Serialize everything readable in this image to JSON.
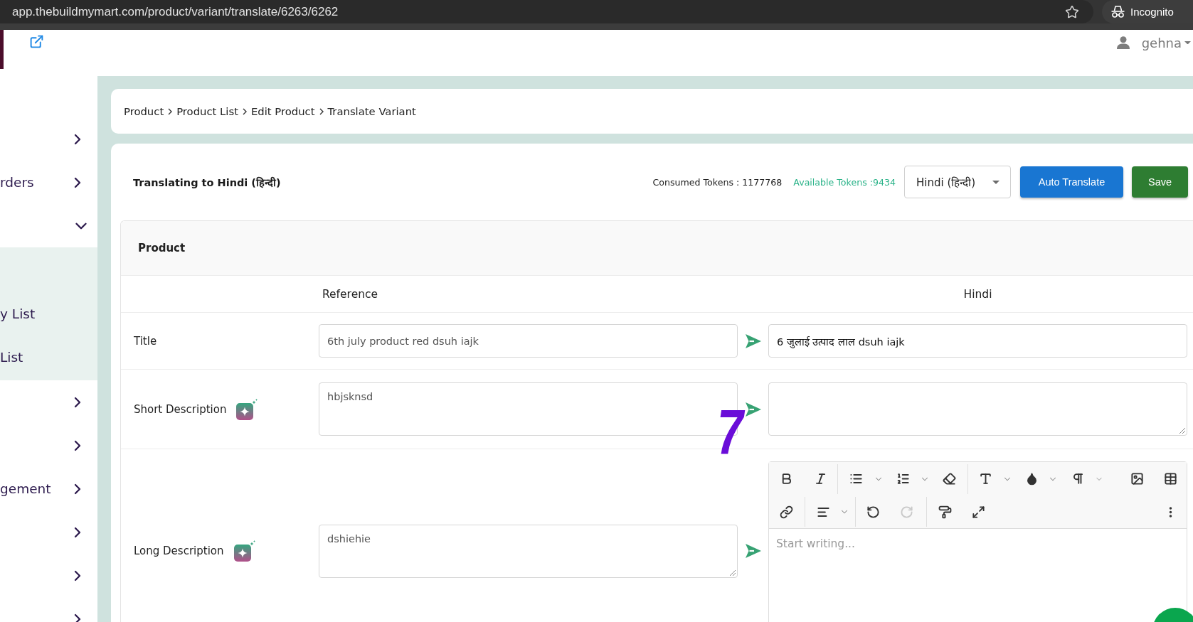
{
  "browser": {
    "url": "app.thebuildmymart.com/product/variant/translate/6263/6262",
    "profile": "Incognito"
  },
  "header": {
    "user": "gehna"
  },
  "sidebar": {
    "items": [
      {
        "expanded": false
      },
      {
        "label": "rders",
        "expanded": false
      },
      {
        "expanded": true,
        "children": [
          {
            "label": "y List"
          },
          {
            "label": "List"
          }
        ]
      },
      {
        "expanded": false
      },
      {
        "expanded": false
      },
      {
        "label": "gement",
        "expanded": false
      },
      {
        "expanded": false
      },
      {
        "expanded": false
      },
      {
        "expanded": false
      }
    ]
  },
  "breadcrumb": [
    "Product",
    "Product List",
    "Edit Product",
    "Translate Variant"
  ],
  "page": {
    "title": "Translating to Hindi (हिन्दी)",
    "consumed_tokens": "Consumed Tokens : 1177768",
    "available_tokens": "Available Tokens :9434",
    "language_select": {
      "value": "Hindi (हिन्दी)"
    },
    "buttons": [
      {
        "label": "Auto Translate",
        "kind": "primary"
      },
      {
        "label": "Save",
        "kind": "success"
      }
    ]
  },
  "section": {
    "title": "Product",
    "columns": [
      "Reference",
      "Hindi"
    ],
    "fields": [
      {
        "label": "Title",
        "ai_assist": false,
        "reference": {
          "kind": "input",
          "value": "6th july product red dsuh iajk"
        },
        "translation": {
          "kind": "input",
          "value": "6 जुलाई उत्पाद लाल dsuh iajk"
        }
      },
      {
        "label": "Short Description",
        "ai_assist": true,
        "reference": {
          "kind": "textarea",
          "value": "hbjsknsd",
          "resize_handle": false
        },
        "translation": {
          "kind": "textarea",
          "resize_handle": true
        }
      },
      {
        "label": "Long Description",
        "ai_assist": true,
        "reference": {
          "kind": "textarea",
          "value": "dshiehie",
          "resize_handle": true
        },
        "translation": {
          "kind": "editor",
          "placeholder": "Start writing...",
          "undo": {
            "disabled": false
          },
          "redo": {
            "disabled": true
          }
        }
      }
    ]
  },
  "annotation": {
    "text": "7"
  }
}
